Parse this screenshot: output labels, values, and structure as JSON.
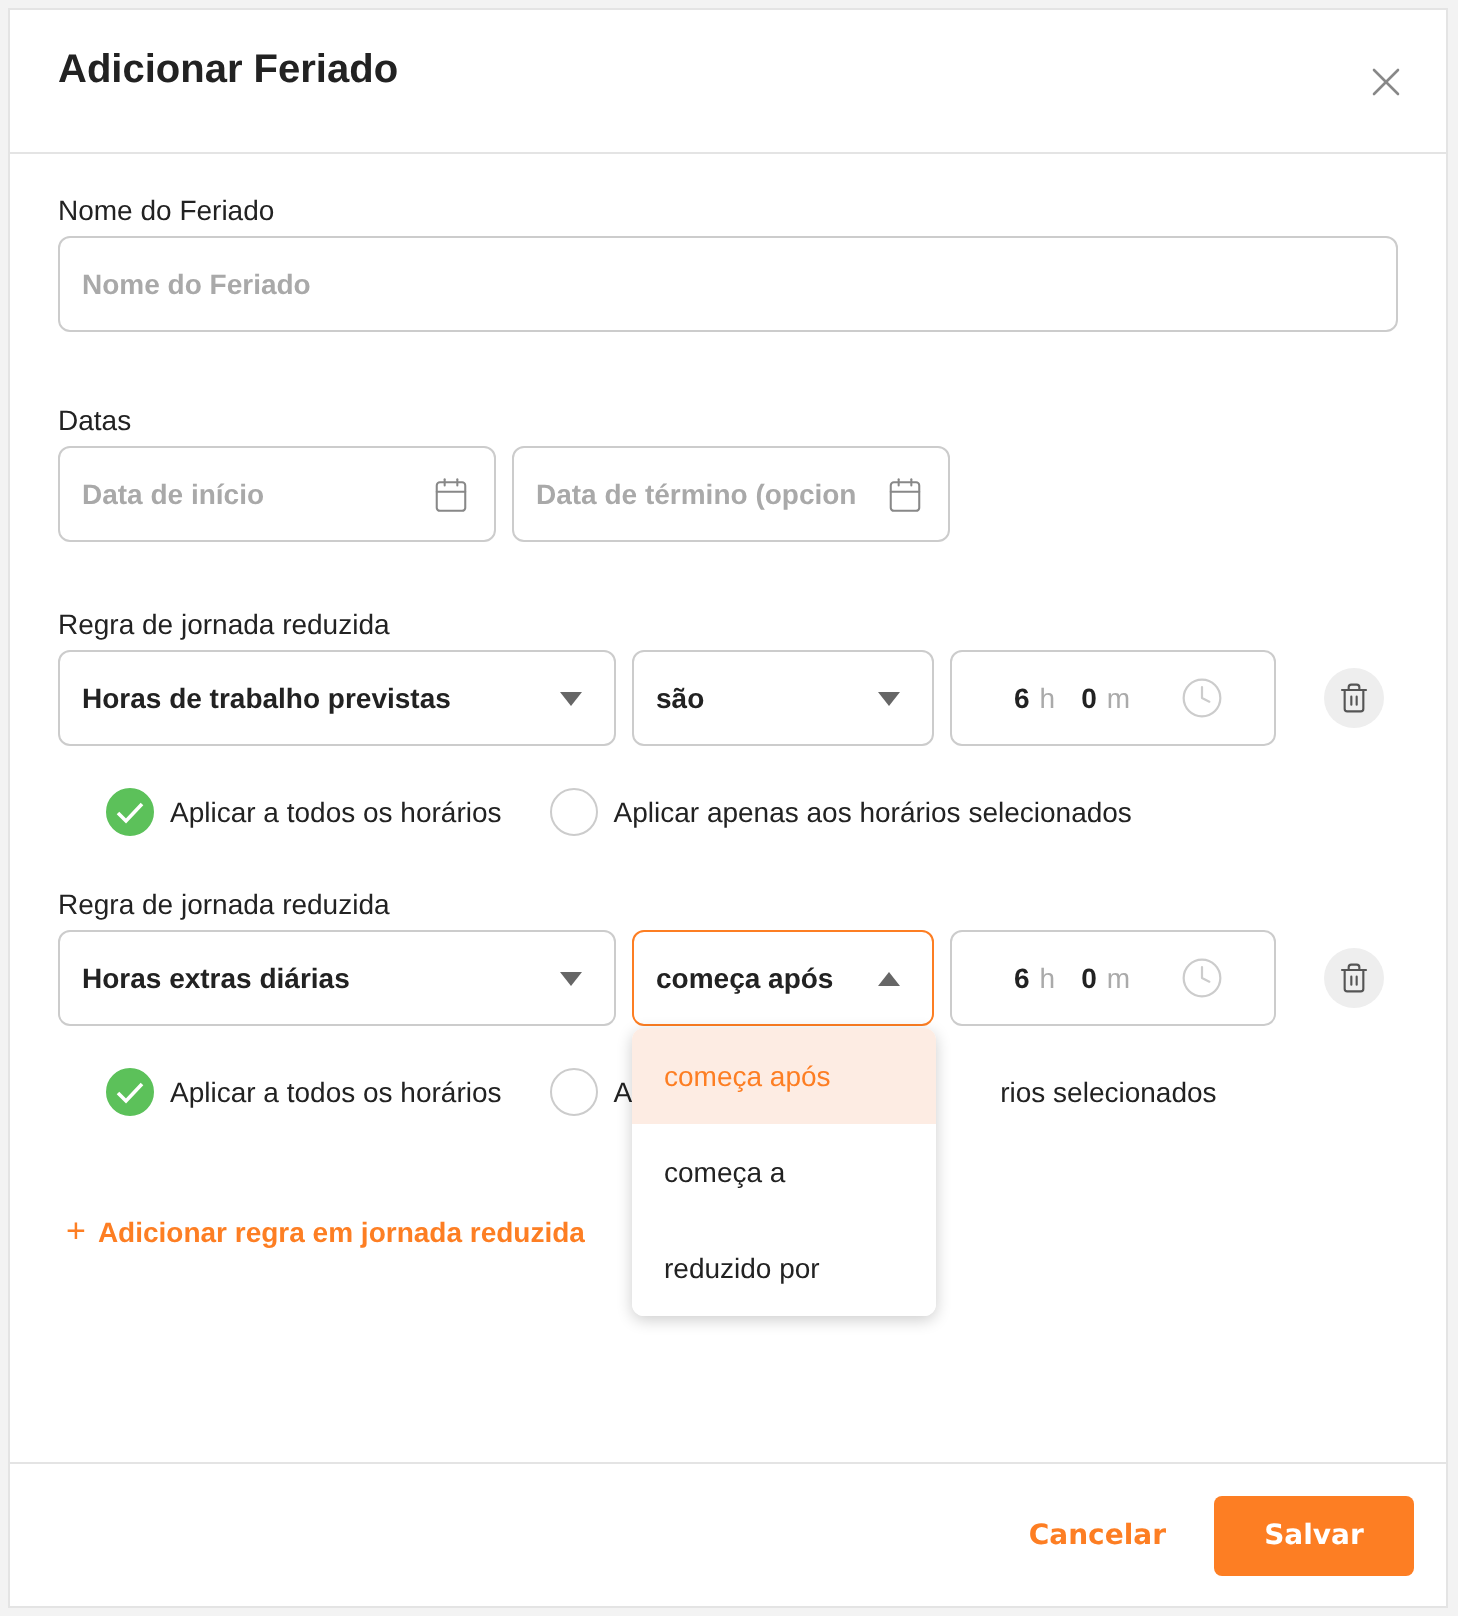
{
  "title": "Adicionar Feriado",
  "name_field": {
    "label": "Nome do Feriado",
    "placeholder": "Nome do Feriado"
  },
  "dates": {
    "label": "Datas",
    "fields": [
      {
        "placeholder": "Data de início"
      },
      {
        "placeholder": "Data de término (opcion"
      }
    ]
  },
  "rules": [
    {
      "label": "Regra de jornada reduzida",
      "metric": "Horas de trabalho previstas",
      "operator": {
        "value": "são",
        "open": false
      },
      "hours": "6",
      "hours_unit": "h",
      "minutes": "0",
      "minutes_unit": "m",
      "options": [
        {
          "label": "Aplicar a todos os horários",
          "selected": true
        },
        {
          "label": "Aplicar apenas aos horários selecionados",
          "selected": false
        }
      ]
    },
    {
      "label": "Regra de jornada reduzida",
      "metric": "Horas extras diárias",
      "operator": {
        "value": "começa após",
        "open": true,
        "menu": [
          {
            "label": "começa após",
            "selected": true
          },
          {
            "label": "começa a",
            "selected": false
          },
          {
            "label": "reduzido por",
            "selected": false
          }
        ]
      },
      "hours": "6",
      "hours_unit": "h",
      "minutes": "0",
      "minutes_unit": "m",
      "options": [
        {
          "label": "Aplicar a todos os horários",
          "selected": true
        },
        {
          "label_parts": [
            "A",
            "rios selecionados"
          ],
          "selected": false
        }
      ]
    }
  ],
  "add_rule": {
    "icon": "+",
    "label": "Adicionar regra em jornada reduzida"
  },
  "buttons": {
    "cancel": "Cancelar",
    "save": "Salvar"
  }
}
